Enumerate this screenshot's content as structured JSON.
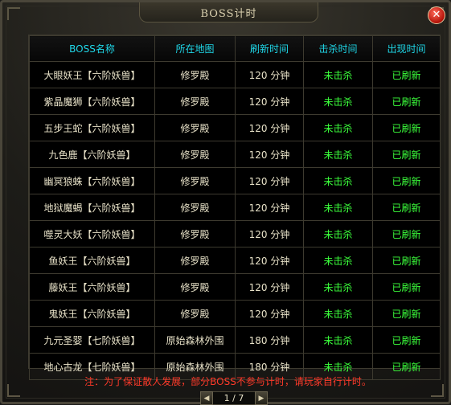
{
  "window": {
    "title": "BOSS计时",
    "close_label": "✕"
  },
  "table": {
    "headers": [
      "BOSS名称",
      "所在地图",
      "刷新时间",
      "击杀时间",
      "出现时间"
    ],
    "rows": [
      {
        "name": "大眼妖王【六阶妖兽】",
        "map": "修罗殿",
        "refresh": "120 分钟",
        "kill": "未击杀",
        "appear": "已刷新"
      },
      {
        "name": "紫晶魔狮【六阶妖兽】",
        "map": "修罗殿",
        "refresh": "120 分钟",
        "kill": "未击杀",
        "appear": "已刷新"
      },
      {
        "name": "五步王蛇【六阶妖兽】",
        "map": "修罗殿",
        "refresh": "120 分钟",
        "kill": "未击杀",
        "appear": "已刷新"
      },
      {
        "name": "九色鹿【六阶妖兽】",
        "map": "修罗殿",
        "refresh": "120 分钟",
        "kill": "未击杀",
        "appear": "已刷新"
      },
      {
        "name": "幽冥狼蛛【六阶妖兽】",
        "map": "修罗殿",
        "refresh": "120 分钟",
        "kill": "未击杀",
        "appear": "已刷新"
      },
      {
        "name": "地狱魔蝎【六阶妖兽】",
        "map": "修罗殿",
        "refresh": "120 分钟",
        "kill": "未击杀",
        "appear": "已刷新"
      },
      {
        "name": "噬灵大妖【六阶妖兽】",
        "map": "修罗殿",
        "refresh": "120 分钟",
        "kill": "未击杀",
        "appear": "已刷新"
      },
      {
        "name": "鱼妖王【六阶妖兽】",
        "map": "修罗殿",
        "refresh": "120 分钟",
        "kill": "未击杀",
        "appear": "已刷新"
      },
      {
        "name": "藤妖王【六阶妖兽】",
        "map": "修罗殿",
        "refresh": "120 分钟",
        "kill": "未击杀",
        "appear": "已刷新"
      },
      {
        "name": "鬼妖王【六阶妖兽】",
        "map": "修罗殿",
        "refresh": "120 分钟",
        "kill": "未击杀",
        "appear": "已刷新"
      },
      {
        "name": "九元圣婴【七阶妖兽】",
        "map": "原始森林外围",
        "refresh": "180 分钟",
        "kill": "未击杀",
        "appear": "已刷新"
      },
      {
        "name": "地心古龙【七阶妖兽】",
        "map": "原始森林外围",
        "refresh": "180 分钟",
        "kill": "未击杀",
        "appear": "已刷新"
      }
    ]
  },
  "note": "注：为了保证散人发展，部分BOSS不参与计时，请玩家自行计时。",
  "pager": {
    "prev_icon": "◀",
    "text": "1 / 7",
    "next_icon": "▶"
  },
  "colors": {
    "header_text": "#1fd7e8",
    "status_green": "#3bff3b",
    "note_red": "#ff3a2a"
  }
}
